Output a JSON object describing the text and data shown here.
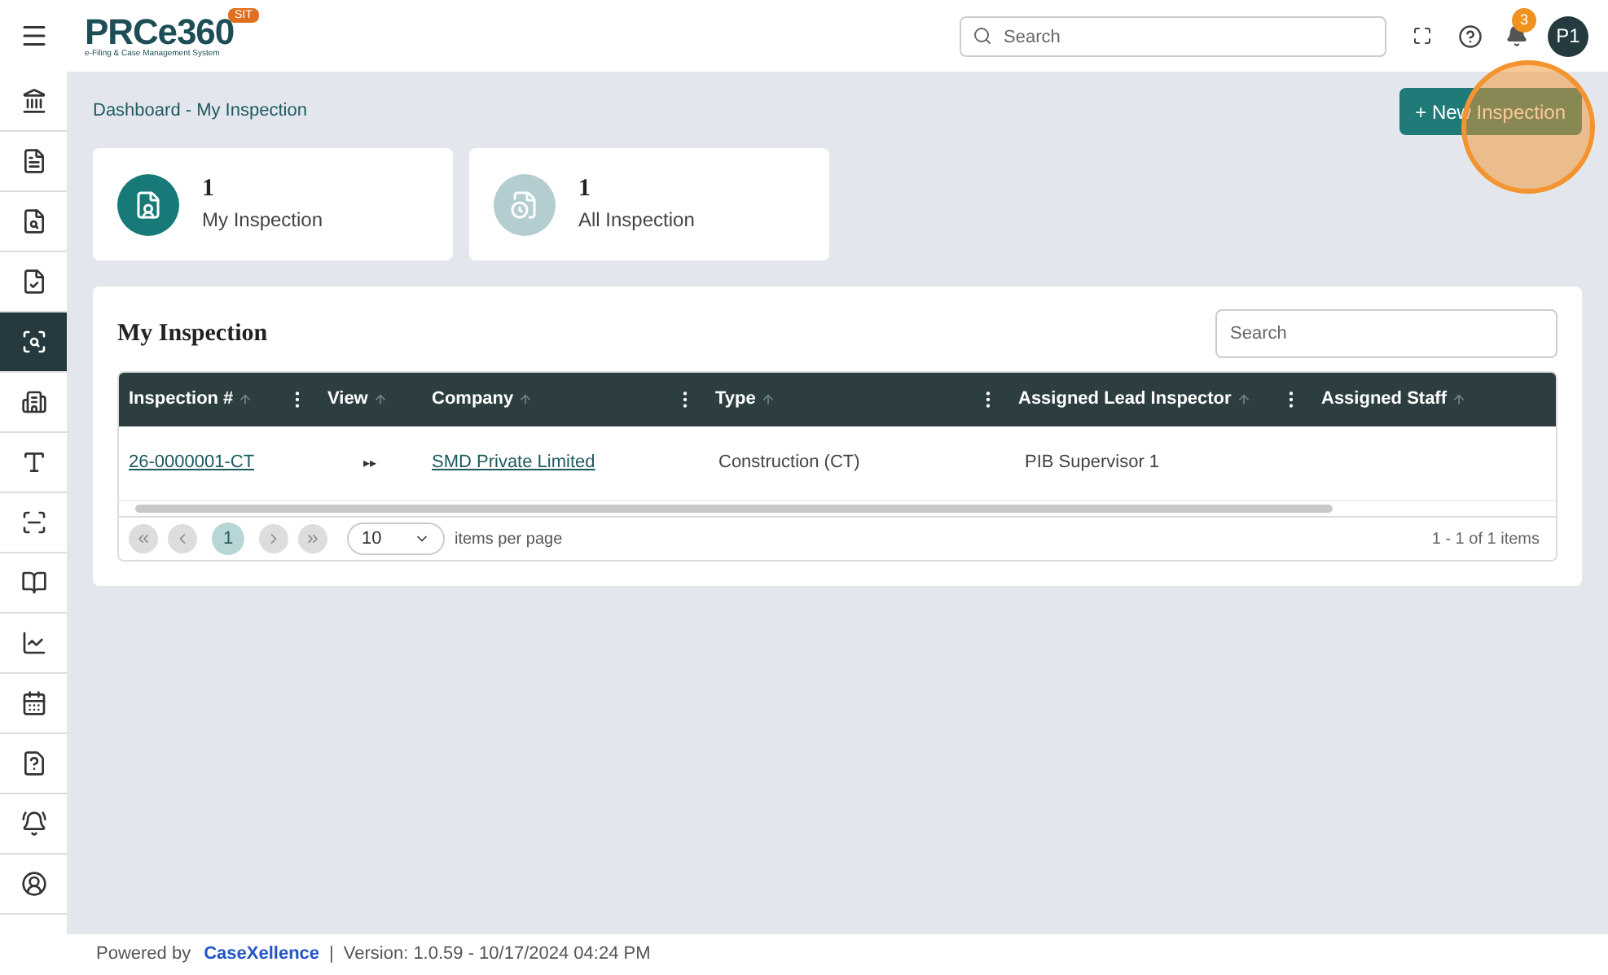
{
  "header": {
    "logo": "PRCe360",
    "logo_subtitle": "e-Filing & Case Management System",
    "env_badge": "SIT",
    "search": {
      "placeholder": "Search"
    },
    "notification_count": "3",
    "avatar": "P1"
  },
  "sidebar": {
    "items": [
      {
        "selected": false
      },
      {
        "selected": false
      },
      {
        "selected": false
      },
      {
        "selected": false
      },
      {
        "selected": true
      },
      {
        "selected": false
      },
      {
        "selected": false
      },
      {
        "selected": false
      },
      {
        "selected": false
      },
      {
        "selected": false
      },
      {
        "selected": false
      },
      {
        "selected": false
      },
      {
        "selected": false
      },
      {
        "selected": false
      }
    ]
  },
  "breadcrumb": "Dashboard - My Inspection",
  "new_button": "+ New Inspection",
  "stat_cards": [
    {
      "count": "1",
      "label": "My Inspection",
      "selected": true
    },
    {
      "count": "1",
      "label": "All Inspection",
      "selected": false
    }
  ],
  "table_card": {
    "title": "My Inspection",
    "search": {
      "placeholder": "Search"
    },
    "columns": [
      {
        "label": "Inspection #",
        "menu": true
      },
      {
        "label": "View",
        "menu": false
      },
      {
        "label": "Company",
        "menu": true
      },
      {
        "label": "Type",
        "menu": true
      },
      {
        "label": "Assigned Lead Inspector",
        "menu": true
      },
      {
        "label": "Assigned Staff",
        "menu": false
      }
    ],
    "rows": [
      {
        "inspection": "26-0000001-CT",
        "view": "▸▸",
        "company": "SMD Private Limited",
        "type": "Construction (CT)",
        "lead": "PIB Supervisor 1"
      }
    ],
    "pager": {
      "page": "1",
      "page_size": "10",
      "page_size_label": "items per page",
      "summary": "1 - 1 of 1 items"
    }
  },
  "footer": {
    "powered_by": "Powered by",
    "brand": "CaseXellence",
    "separator": "|",
    "version": "Version: 1.0.59 - 10/17/2024 04:24 PM"
  }
}
